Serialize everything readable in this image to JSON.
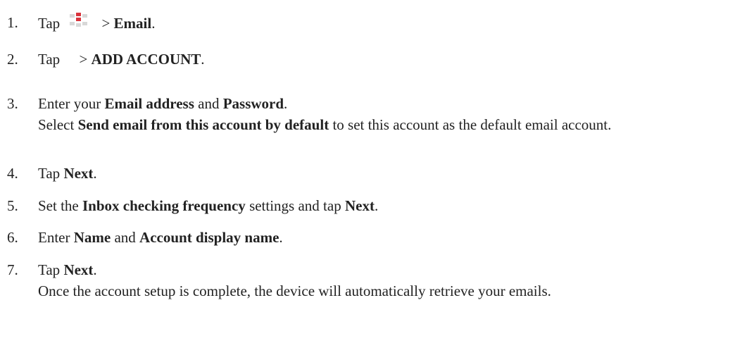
{
  "steps": [
    {
      "num": "1.",
      "pre": "Tap",
      "icon": "apps-grid-icon",
      "mid": " > ",
      "b1": "Email",
      "post": "."
    },
    {
      "num": "2.",
      "pre": "Tap",
      "icon": "menu-icon",
      "mid": " > ",
      "b1": "ADD ACCOUNT",
      "post": "."
    },
    {
      "num": "3.",
      "t1": "Enter your ",
      "b1": "Email address",
      "t2": " and ",
      "b2": "Password",
      "t3": "."
    },
    {
      "num": "4.",
      "t1": "Tap ",
      "b1": "Next",
      "t2": "."
    },
    {
      "num": "5.",
      "t1": "Set the ",
      "b1": "Inbox checking frequency",
      "t2": " settings and tap ",
      "b2": "Next",
      "t3": "."
    },
    {
      "num": "6.",
      "t1": "Enter ",
      "b1": "Name",
      "t2": " and ",
      "b2": "Account display name",
      "t3": "."
    },
    {
      "num": "7.",
      "t1": "Tap ",
      "b1": "Next",
      "t2": "."
    }
  ],
  "note3": {
    "t1": "Select ",
    "b1": "Send email from this account by default",
    "t2": " to set this account as the default email account."
  },
  "note7": {
    "t1": "Once the account setup is complete, the device will automatically retrieve your emails."
  }
}
